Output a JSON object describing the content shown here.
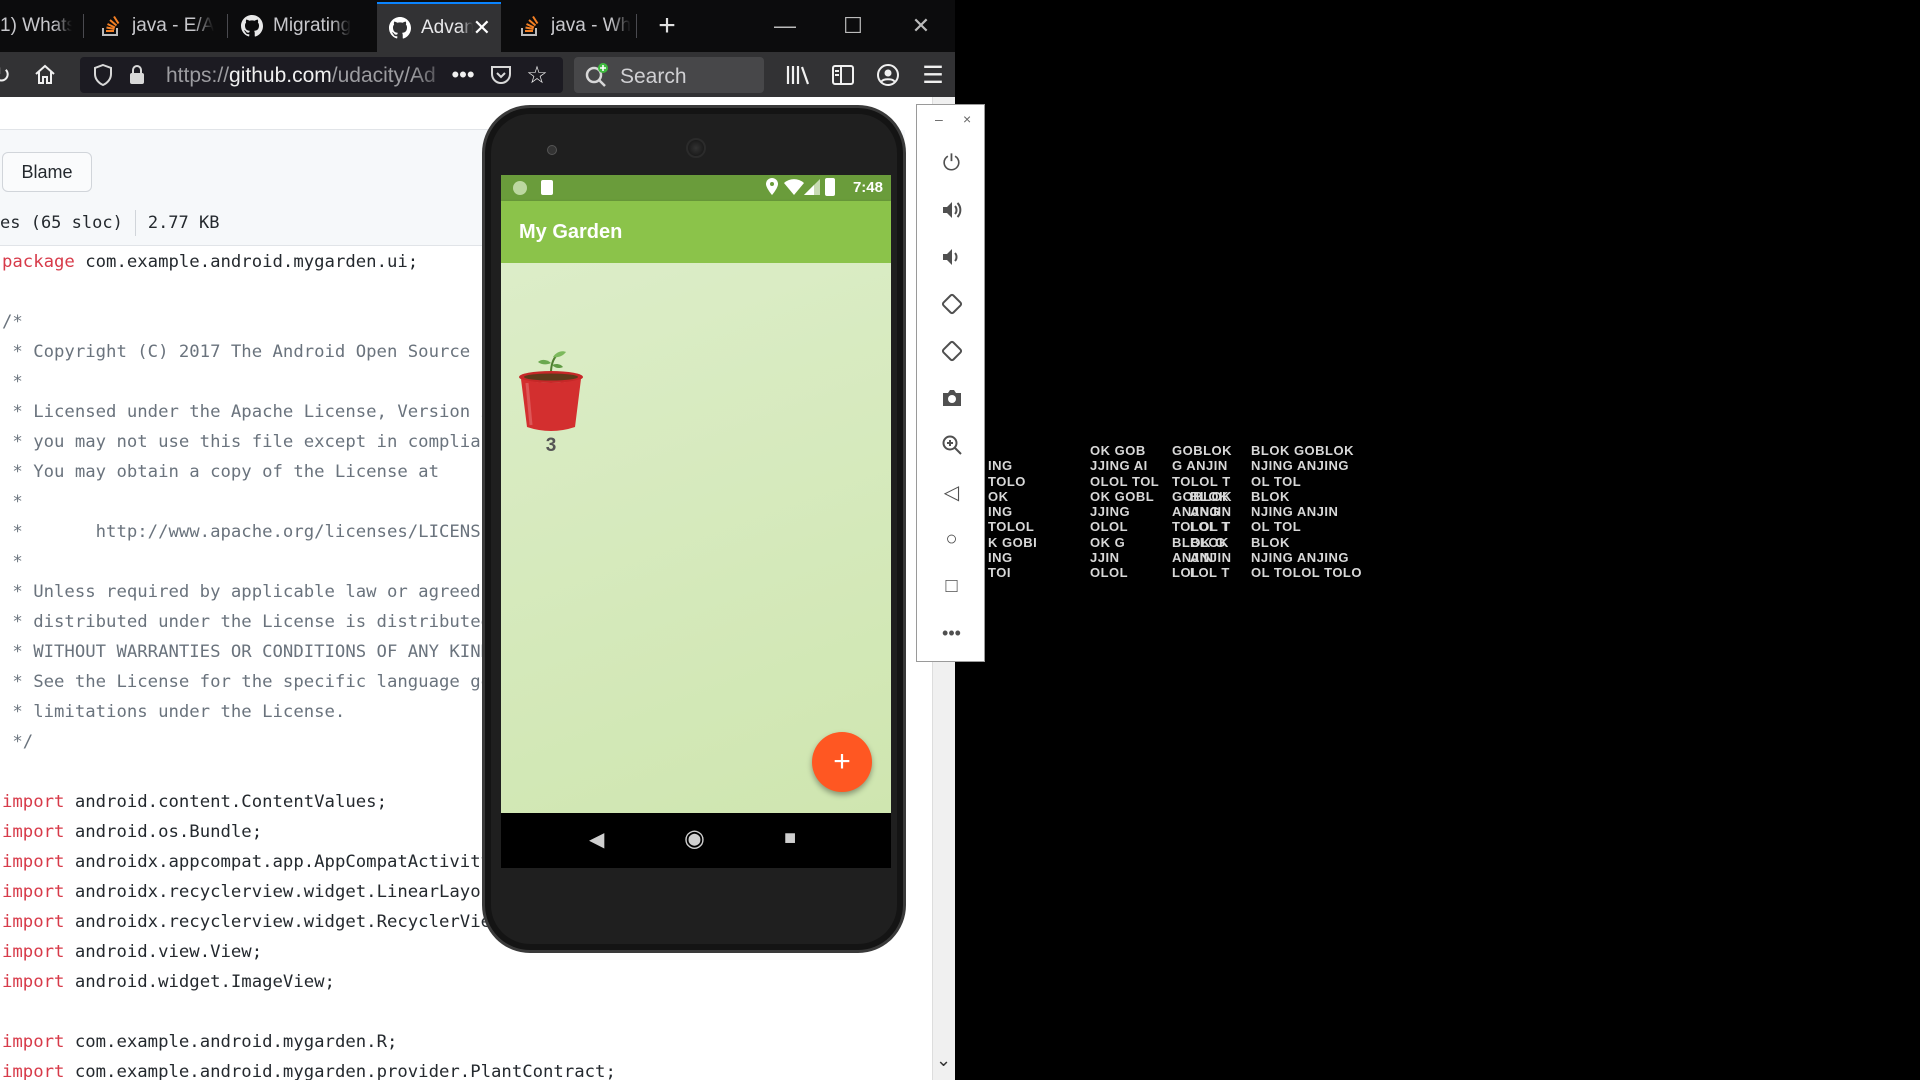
{
  "browser": {
    "tabs": [
      {
        "label": "1) Whats",
        "icon": "whatsapp-icon"
      },
      {
        "label": "java - E/A",
        "icon": "stackoverflow-icon"
      },
      {
        "label": "Migrating",
        "icon": "github-icon"
      },
      {
        "label": "Advan",
        "icon": "github-icon",
        "active": true
      },
      {
        "label": "java - Wh",
        "icon": "stackoverflow-icon"
      }
    ],
    "new_tab": "+",
    "window_controls": {
      "minimize": "—",
      "maximize": "☐",
      "close": "✕"
    },
    "url_prefix": "https://",
    "url_domain": "github.com",
    "url_path": "/udacity/Ad",
    "search_placeholder": "Search"
  },
  "github": {
    "blame_label": "Blame",
    "file_lines": "es (65 sloc)",
    "file_size": "2.77 KB",
    "code_lines": [
      [
        {
          "t": "package",
          "c": "kw"
        },
        {
          "t": " com.example.android.mygarden.ui;"
        }
      ],
      [
        {
          "t": ""
        }
      ],
      [
        {
          "t": "/*",
          "c": "cm"
        }
      ],
      [
        {
          "t": " * Copyright (C) 2017 The Android Open Source Pro",
          "c": "cm"
        }
      ],
      [
        {
          "t": " *",
          "c": "cm"
        }
      ],
      [
        {
          "t": " * Licensed under the Apache License, Version 2.0",
          "c": "cm"
        }
      ],
      [
        {
          "t": " * you may not use this file except in compliance",
          "c": "cm"
        }
      ],
      [
        {
          "t": " * You may obtain a copy of the License at",
          "c": "cm"
        }
      ],
      [
        {
          "t": " *",
          "c": "cm"
        }
      ],
      [
        {
          "t": " *       http://www.apache.org/licenses/LICENSE-2",
          "c": "cm"
        }
      ],
      [
        {
          "t": " *",
          "c": "cm"
        }
      ],
      [
        {
          "t": " * Unless required by applicable law or agreed to",
          "c": "cm"
        }
      ],
      [
        {
          "t": " * distributed under the License is distributed o",
          "c": "cm"
        }
      ],
      [
        {
          "t": " * WITHOUT WARRANTIES OR CONDITIONS OF ANY KIND, e",
          "c": "cm"
        }
      ],
      [
        {
          "t": " * See the License for the specific language gove",
          "c": "cm"
        }
      ],
      [
        {
          "t": " * limitations under the License.",
          "c": "cm"
        }
      ],
      [
        {
          "t": " */",
          "c": "cm"
        }
      ],
      [
        {
          "t": ""
        }
      ],
      [
        {
          "t": "import",
          "c": "kw"
        },
        {
          "t": " android.content.ContentValues;"
        }
      ],
      [
        {
          "t": "import",
          "c": "kw"
        },
        {
          "t": " android.os.Bundle;"
        }
      ],
      [
        {
          "t": "import",
          "c": "kw"
        },
        {
          "t": " androidx.appcompat.app.AppCompatActivity;"
        }
      ],
      [
        {
          "t": "import",
          "c": "kw"
        },
        {
          "t": " androidx.recyclerview.widget.LinearLayoutM"
        }
      ],
      [
        {
          "t": "import",
          "c": "kw"
        },
        {
          "t": " androidx.recyclerview.widget.RecyclerView;"
        }
      ],
      [
        {
          "t": "import",
          "c": "kw"
        },
        {
          "t": " android.view.View;"
        }
      ],
      [
        {
          "t": "import",
          "c": "kw"
        },
        {
          "t": " android.widget.ImageView;"
        }
      ],
      [
        {
          "t": ""
        }
      ],
      [
        {
          "t": "import",
          "c": "kw"
        },
        {
          "t": " com.example.android.mygarden.R;"
        }
      ],
      [
        {
          "t": "import",
          "c": "kw"
        },
        {
          "t": " com.example.android.mygarden.provider.PlantContract;"
        }
      ]
    ]
  },
  "emulator": {
    "status_time": "7:48",
    "app_title": "My Garden",
    "plant_count": "3",
    "fab_label": "+",
    "accent": "#ff5722",
    "toolbar": {
      "minimize": "–",
      "close": "×",
      "buttons": [
        "power-icon",
        "volume-up-icon",
        "volume-down-icon",
        "rotate-left-icon",
        "rotate-right-icon",
        "camera-icon",
        "zoom-icon",
        "back-icon",
        "home-icon",
        "overview-icon",
        "more-icon"
      ]
    }
  },
  "desktop_text": [
    "  \nING\nTOLO\nOK \nING\nTOLOL\nK GOBI\nING\nTOI",
    "OK GOB\nJJING AI\nOLOL TOL\nOK GOBL\nJJING\nOLOL\nOK G\nJJIN\nOLOL",
    "GOBLOK\nG ANJIN\nTOLOL T\nGOBLOK\nANJNG\nTOLOL T\nBLOK G\nANJIN\nLOL",
    "\n\n\nBLOK\nANJIN\nLOL T\nBLOK\nANJIN\nLOL T",
    "BLOK GOBLOK\nNJING ANJING\nOL TOL\nBLOK\nNJING ANJIN\nOL TOL\nBLOK\nNJING ANJING\nOL TOLOL TOLO"
  ]
}
